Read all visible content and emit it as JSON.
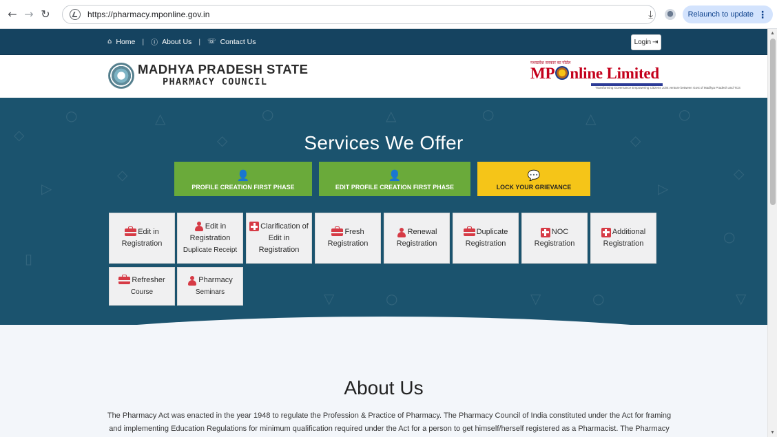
{
  "browser": {
    "url": "https://pharmacy.mponline.gov.in",
    "relaunch_label": "Relaunch to update"
  },
  "topnav": {
    "home": "Home",
    "about": "About Us",
    "contact": "Contact Us",
    "login": "Login"
  },
  "header": {
    "title_line1": "MADHYA PRADESH STATE",
    "title_line2": "PHARMACY COUNCIL",
    "mp_tagline": "मध्यप्रदेश सरकार का पोर्टल",
    "mp_name_pre": "MP",
    "mp_name_post": "nline Limited",
    "mp_subline": "Transforming Governance Empowering Citizens",
    "mp_subline2": "Joint venture between Govt of Madhya Pradesh and TCS"
  },
  "services": {
    "title": "Services We Offer",
    "buttons": [
      {
        "label": "PROFILE CREATION FIRST PHASE",
        "icon": "user-icon",
        "color": "#6aaa3a"
      },
      {
        "label": "EDIT PROFILE CREATION FIRST PHASE",
        "icon": "user-icon",
        "color": "#6aaa3a"
      },
      {
        "label": "LOCK YOUR GRIEVANCE",
        "icon": "chat-icon",
        "color": "#f5c518"
      }
    ],
    "cards": [
      {
        "line1": "Edit in",
        "line2": "Registration",
        "line3": "",
        "icon": "briefcase-icon"
      },
      {
        "line1": "Edit in",
        "line2": "Registration",
        "line3": "Duplicate Receipt",
        "icon": "user-md-icon"
      },
      {
        "line1": "Clarification of",
        "line2": "Edit in Registration",
        "line3": "",
        "icon": "medkit-icon"
      },
      {
        "line1": "Fresh",
        "line2": "Registration",
        "line3": "",
        "icon": "briefcase-icon"
      },
      {
        "line1": "Renewal",
        "line2": "Registration",
        "line3": "",
        "icon": "user-md-icon"
      },
      {
        "line1": "Duplicate",
        "line2": "Registration",
        "line3": "",
        "icon": "briefcase-icon"
      },
      {
        "line1": "NOC",
        "line2": "Registration",
        "line3": "",
        "icon": "medkit-icon"
      },
      {
        "line1": "Additional",
        "line2": "Registration",
        "line3": "",
        "icon": "medkit-icon"
      },
      {
        "line1": "Refresher",
        "line2": "Course",
        "line3": "",
        "icon": "briefcase-icon"
      },
      {
        "line1": "Pharmacy",
        "line2": "Seminars",
        "line3": "",
        "icon": "user-md-icon"
      }
    ]
  },
  "about": {
    "title": "About Us",
    "text": "The Pharmacy Act was enacted in the year 1948 to regulate the Profession & Practice of Pharmacy. The Pharmacy Council of India constituted under the Act for framing and implementing Education Regulations for minimum qualification required under the Act for a person to get himself/herself registered as a Pharmacist. The Pharmacy Council of"
  },
  "colors": {
    "topbar": "#154360",
    "services_bg": "#1b536e",
    "card_icon": "#d63a45"
  }
}
